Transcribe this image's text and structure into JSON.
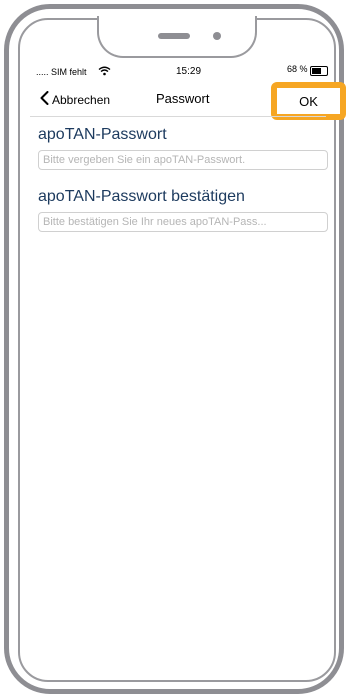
{
  "status_bar": {
    "carrier": "..... SIM fehlt",
    "time": "15:29",
    "battery": "68 %"
  },
  "nav": {
    "back_label": "Abbrechen",
    "title": "Passwort",
    "ok_label": "OK"
  },
  "form": {
    "password": {
      "label": "apoTAN-Passwort",
      "value": "",
      "placeholder": "Bitte vergeben Sie ein apoTAN-Passwort."
    },
    "confirm": {
      "label": "apoTAN-Passwort bestätigen",
      "value": "",
      "placeholder": "Bitte bestätigen Sie Ihr neues apoTAN-Pass..."
    }
  },
  "colors": {
    "highlight": "#f6a623",
    "label": "#1c3a5e",
    "frame": "#8e8e93"
  },
  "icons": {
    "back": "chevron-left-icon",
    "wifi": "wifi-icon",
    "battery": "battery-icon"
  }
}
